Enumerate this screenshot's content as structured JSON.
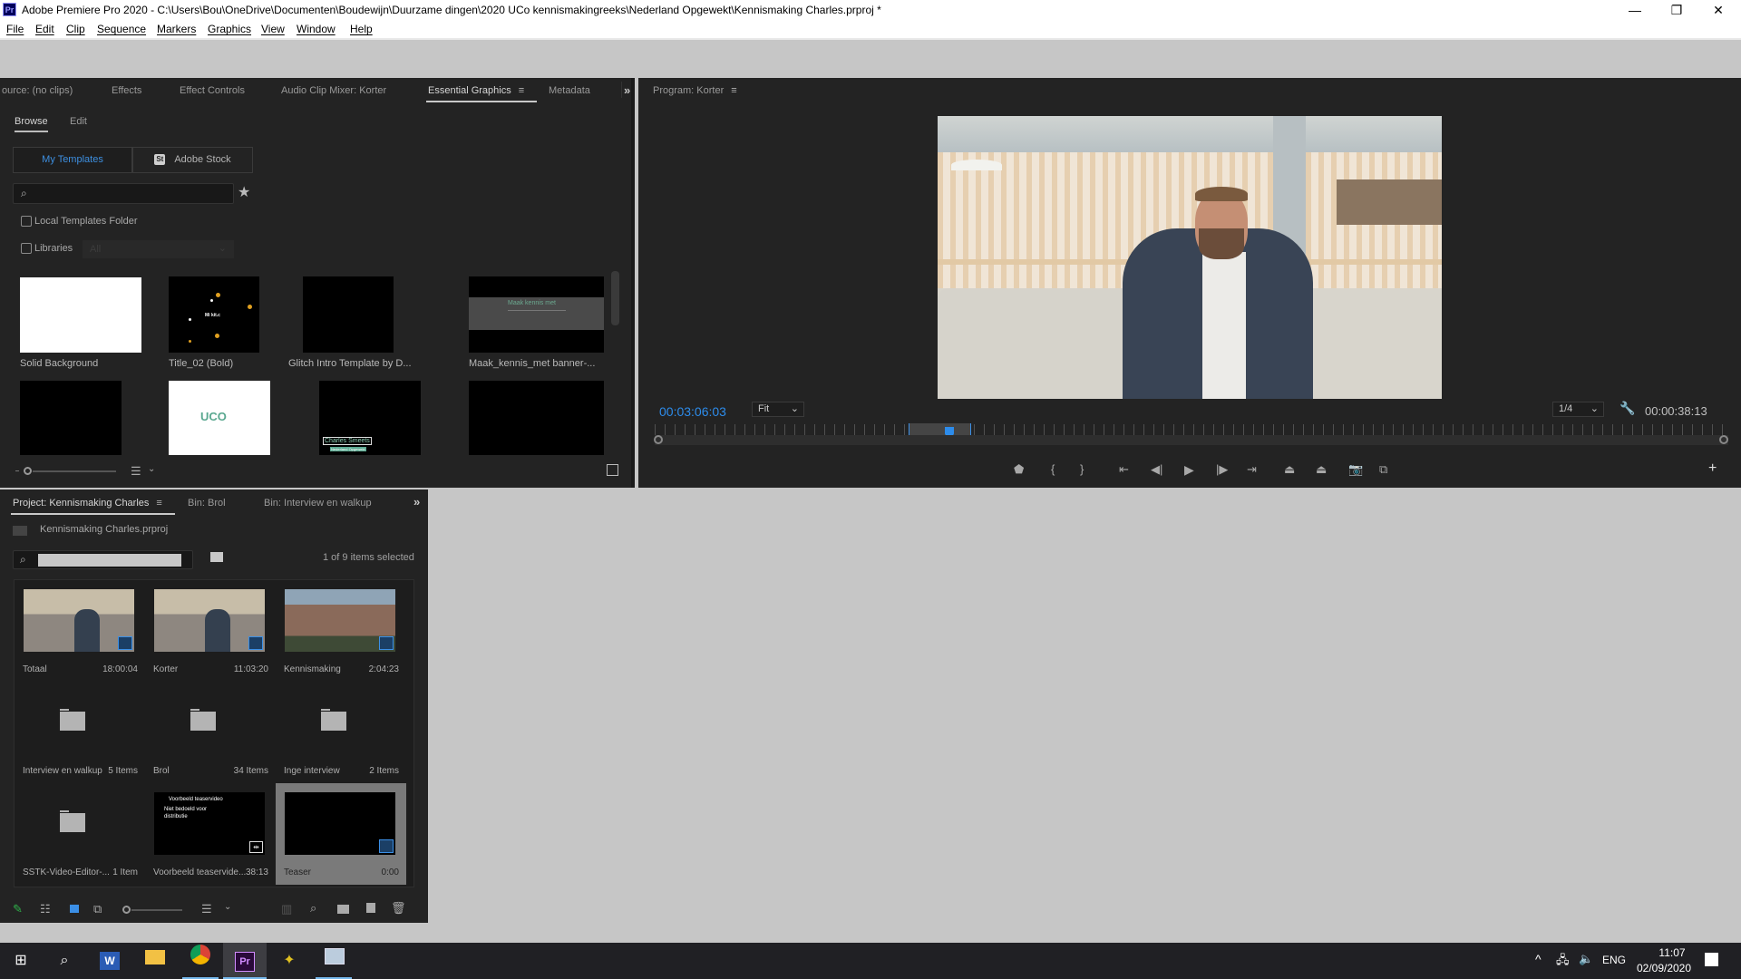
{
  "window": {
    "title": "Adobe Premiere Pro 2020 - C:\\Users\\Bou\\OneDrive\\Documenten\\Boudewijn\\Duurzame dingen\\2020 UCo kennismakingreeks\\Nederland Opgewekt\\Kennismaking Charles.prproj *",
    "app_icon": "Pr",
    "controls": {
      "minimize": "—",
      "restore": "❐",
      "close": "✕"
    }
  },
  "menu": [
    "File",
    "Edit",
    "Clip",
    "Sequence",
    "Markers",
    "Graphics",
    "View",
    "Window",
    "Help"
  ],
  "top_left_panel": {
    "tabs": [
      "ource: (no clips)",
      "Effects",
      "Effect Controls",
      "Audio Clip Mixer: Korter",
      "Essential Graphics",
      "Metadata"
    ],
    "active_tab": "Essential Graphics",
    "more_icon": "»",
    "subtabs": [
      "Browse",
      "Edit"
    ],
    "source_toggle": {
      "my_templates": "My Templates",
      "adobe_stock": "Adobe Stock",
      "stock_badge": "St"
    },
    "search": {
      "value": "",
      "placeholder": ""
    },
    "local_templates_label": "Local Templates Folder",
    "libraries_label": "Libraries",
    "libraries_select": "All",
    "templates": [
      {
        "name": "Solid Background",
        "thumb": "white"
      },
      {
        "name": "Title_02 (Bold)",
        "thumb": "dots",
        "thumb_text": "Mi kit.c"
      },
      {
        "name": "Glitch Intro Template by D...",
        "thumb": "black"
      },
      {
        "name": "Maak_kennis_met banner-...",
        "thumb": "banner",
        "thumb_text": "Maak kennis met"
      },
      {
        "name": "",
        "thumb": "black"
      },
      {
        "name": "",
        "thumb": "uco",
        "thumb_text": "UCO"
      },
      {
        "name": "",
        "thumb": "lowerthird",
        "thumb_text": "Charles Smeets",
        "thumb_subtext": "Nederland Opgewekt"
      },
      {
        "name": "",
        "thumb": "black"
      }
    ]
  },
  "program_monitor": {
    "title": "Program: Korter",
    "current_timecode": "00:03:06:03",
    "zoom_select": "Fit",
    "resolution_select": "1/4",
    "duration_timecode": "00:00:38:13",
    "playhead_fraction": 0.275,
    "transport": [
      "add-marker",
      "mark-in",
      "mark-out",
      "go-to-in",
      "step-back",
      "play",
      "step-forward",
      "go-to-out",
      "lift",
      "extract",
      "export-frame",
      "comparison-view"
    ],
    "add_button": "+"
  },
  "project_panel": {
    "tabs": [
      "Project: Kennismaking Charles",
      "Bin: Brol",
      "Bin: Interview en walkup"
    ],
    "active_tab": "Project: Kennismaking Charles",
    "project_file": "Kennismaking Charles.prproj",
    "search": {
      "value": "",
      "placeholder": ""
    },
    "selection_status": "1 of 9 items selected",
    "items": [
      {
        "name": "Totaal",
        "info": "18:00:04",
        "type": "sequence",
        "thumb": "interview"
      },
      {
        "name": "Korter",
        "info": "11:03:20",
        "type": "sequence",
        "thumb": "interview"
      },
      {
        "name": "Kennismaking",
        "info": "2:04:23",
        "type": "sequence",
        "thumb": "building"
      },
      {
        "name": "Interview en walkup",
        "info": "5 Items",
        "type": "bin"
      },
      {
        "name": "Brol",
        "info": "34 Items",
        "type": "bin"
      },
      {
        "name": "Inge interview",
        "info": "2 Items",
        "type": "bin"
      },
      {
        "name": "SSTK-Video-Editor-...",
        "info": "1 Item",
        "type": "bin"
      },
      {
        "name": "Voorbeeld teaservide...",
        "info": "38:13",
        "type": "clip",
        "thumb_line1": "Voorbeeld teaservideo",
        "thumb_line2": "Niet bedoeld voor",
        "thumb_line3": "distributie"
      },
      {
        "name": "Teaser",
        "info": "0:00",
        "type": "sequence",
        "thumb": "black",
        "selected": true
      }
    ]
  },
  "taskbar": {
    "apps": [
      "start",
      "search",
      "word",
      "file-explorer",
      "chrome",
      "premiere-pro",
      "app-yellow",
      "resource-monitor"
    ],
    "language": "ENG",
    "time": "11:07",
    "date": "02/09/2020"
  },
  "colors": {
    "accent_blue": "#2d8ceb",
    "panel_bg": "#232323",
    "selected_item": "#7a7a7a"
  }
}
